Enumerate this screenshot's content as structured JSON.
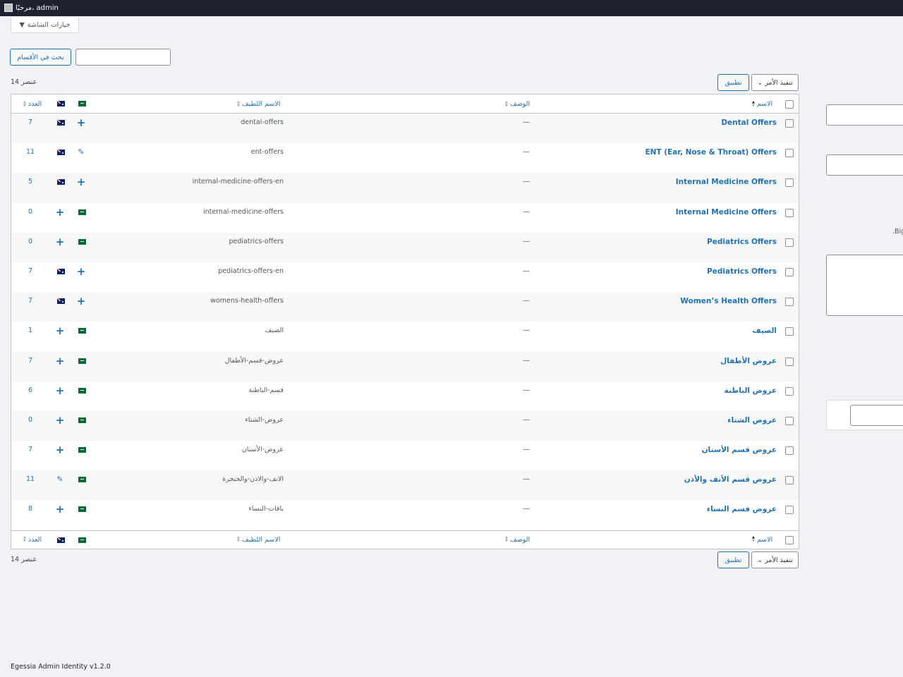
{
  "adminbar": {
    "greeting": "مرحبًا، admin"
  },
  "screen_options": {
    "label": "خيارات الشاشة",
    "arrow": "▼"
  },
  "search": {
    "button": "بحث في الأقسام",
    "value": ""
  },
  "items_count": "14 عنصر",
  "bulk": {
    "select": "تنفيذ الأمر",
    "apply": "تطبيق"
  },
  "columns": {
    "name": "الاسم",
    "description": "الوصف",
    "slug": "الاسم اللطيف",
    "count": "العدد"
  },
  "rows": [
    {
      "name": "Dental Offers",
      "desc": "—",
      "slug": "dental-offers",
      "lang": "en",
      "action": "plus",
      "count": "7"
    },
    {
      "name": "ENT (Ear, Nose & Throat) Offers",
      "desc": "—",
      "slug": "ent-offers",
      "lang": "en",
      "action": "pencil",
      "count": "11"
    },
    {
      "name": "Internal Medicine Offers",
      "desc": "—",
      "slug": "internal-medicine-offers-en",
      "lang": "en",
      "action": "plus",
      "count": "5"
    },
    {
      "name": "Internal Medicine Offers",
      "desc": "—",
      "slug": "internal-medicine-offers",
      "lang": "ar",
      "action": "plus",
      "count": "0"
    },
    {
      "name": "Pediatrics Offers",
      "desc": "—",
      "slug": "pediatrics-offers",
      "lang": "ar",
      "action": "plus",
      "count": "0"
    },
    {
      "name": "Pediatrics Offers",
      "desc": "—",
      "slug": "pediatrics-offers-en",
      "lang": "en",
      "action": "plus",
      "count": "7"
    },
    {
      "name": "Women’s Health Offers",
      "desc": "—",
      "slug": "womens-health-offers",
      "lang": "en",
      "action": "plus",
      "count": "7"
    },
    {
      "name": "الصيف",
      "desc": "—",
      "slug": "الصيف",
      "lang": "ar",
      "action": "plus",
      "count": "1"
    },
    {
      "name": "عروض الأطفال",
      "desc": "—",
      "slug": "عروض-قسم-الأطفال",
      "lang": "ar",
      "action": "plus",
      "count": "7"
    },
    {
      "name": "عروض الباطنة",
      "desc": "—",
      "slug": "قسم-الباطنة",
      "lang": "ar",
      "action": "plus",
      "count": "6"
    },
    {
      "name": "عروض الشتاء",
      "desc": "—",
      "slug": "عروض-الشتاء",
      "lang": "ar",
      "action": "plus",
      "count": "0"
    },
    {
      "name": "عروض قسم الأسنان",
      "desc": "—",
      "slug": "عروض-الأسنان",
      "lang": "ar",
      "action": "plus",
      "count": "7"
    },
    {
      "name": "عروض قسم الأنف والأذن",
      "desc": "—",
      "slug": "الانف-والاذن-والحنجرة",
      "lang": "ar",
      "action": "pencil",
      "count": "11"
    },
    {
      "name": "عروض قسم النساء",
      "desc": "—",
      "slug": "باقات-النساء",
      "lang": "ar",
      "action": "plus",
      "count": "8"
    }
  ],
  "side_text": ".Big",
  "footer": "Egessia Admin Identity v1.2.0"
}
